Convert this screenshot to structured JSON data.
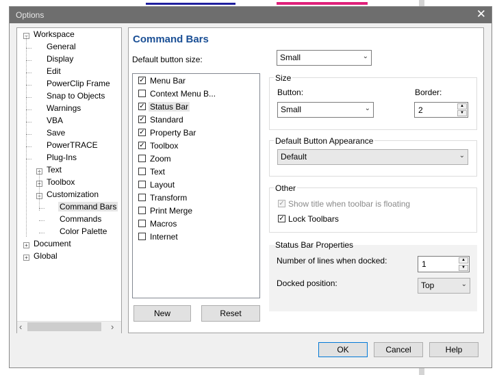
{
  "window": {
    "title": "Options",
    "close_icon": "✕"
  },
  "tree": {
    "nodes": [
      {
        "label": "Workspace",
        "expander": "−"
      },
      {
        "label": "General"
      },
      {
        "label": "Display"
      },
      {
        "label": "Edit"
      },
      {
        "label": "PowerClip Frame"
      },
      {
        "label": "Snap to Objects"
      },
      {
        "label": "Warnings"
      },
      {
        "label": "VBA"
      },
      {
        "label": "Save"
      },
      {
        "label": "PowerTRACE"
      },
      {
        "label": "Plug-Ins"
      },
      {
        "label": "Text",
        "expander": "+"
      },
      {
        "label": "Toolbox",
        "expander": "+"
      },
      {
        "label": "Customization",
        "expander": "−"
      },
      {
        "label": "Command Bars",
        "selected": true
      },
      {
        "label": "Commands"
      },
      {
        "label": "Color Palette"
      },
      {
        "label": "Document",
        "expander": "+"
      },
      {
        "label": "Global",
        "expander": "+"
      }
    ],
    "scroll_left_icon": "‹",
    "scroll_right_icon": "›"
  },
  "page": {
    "heading": "Command Bars",
    "default_button_size_label": "Default button size:",
    "default_button_size_value": "Small",
    "command_bars": [
      {
        "label": "Menu Bar",
        "checked": true
      },
      {
        "label": "Context Menu B...",
        "checked": false
      },
      {
        "label": "Status Bar",
        "checked": true,
        "selected": true
      },
      {
        "label": "Standard",
        "checked": true
      },
      {
        "label": "Property Bar",
        "checked": true
      },
      {
        "label": "Toolbox",
        "checked": true
      },
      {
        "label": "Zoom",
        "checked": false
      },
      {
        "label": "Text",
        "checked": false
      },
      {
        "label": "Layout",
        "checked": false
      },
      {
        "label": "Transform",
        "checked": false
      },
      {
        "label": "Print Merge",
        "checked": false
      },
      {
        "label": "Macros",
        "checked": false
      },
      {
        "label": "Internet",
        "checked": false
      }
    ],
    "new_button": "New",
    "reset_button": "Reset",
    "size_group": {
      "title": "Size",
      "button_label": "Button:",
      "button_value": "Small",
      "border_label": "Border:",
      "border_value": "2"
    },
    "appearance_group": {
      "title": "Default Button Appearance",
      "value": "Default"
    },
    "other_group": {
      "title": "Other",
      "show_title_label": "Show title when toolbar is floating",
      "show_title_checked": true,
      "show_title_disabled": true,
      "lock_toolbars_label": "Lock Toolbars",
      "lock_toolbars_checked": true
    },
    "status_group": {
      "title": "Status Bar Properties",
      "lines_label": "Number of lines when docked:",
      "lines_value": "1",
      "position_label": "Docked position:",
      "position_value": "Top"
    }
  },
  "footer": {
    "ok": "OK",
    "cancel": "Cancel",
    "help": "Help"
  },
  "icons": {
    "check": "✓",
    "dropdown": "⌄",
    "spin_up": "▲",
    "spin_down": "▼"
  }
}
